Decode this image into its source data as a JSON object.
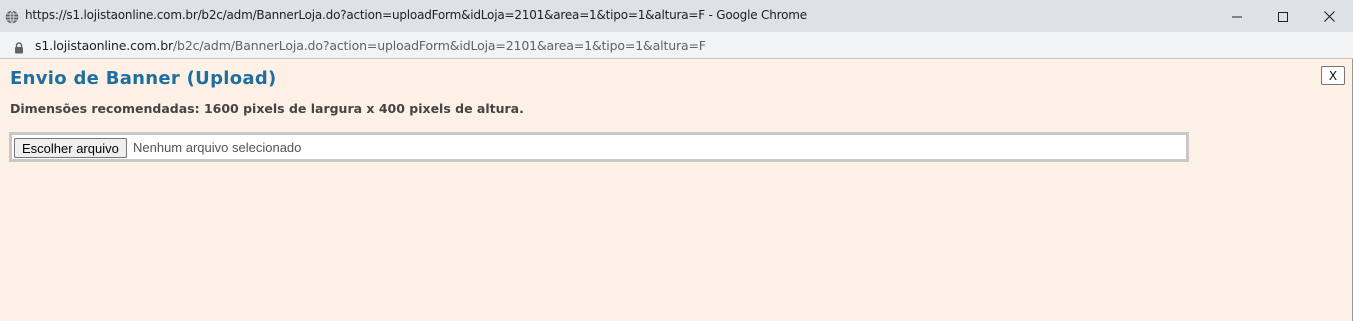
{
  "window": {
    "title": "https://s1.lojistaonline.com.br/b2c/adm/BannerLoja.do?action=uploadForm&idLoja=2101&area=1&tipo=1&altura=F - Google Chrome",
    "icons": {
      "site": "globe-icon",
      "minimize": "minimize-icon",
      "maximize": "maximize-icon",
      "close": "close-icon"
    }
  },
  "addressbar": {
    "icon": "lock-icon",
    "url_host": "s1.lojistaonline.com.br",
    "url_path": "/b2c/adm/BannerLoja.do?action=uploadForm&idLoja=2101&area=1&tipo=1&altura=F"
  },
  "page": {
    "title": "Envio de Banner (Upload)",
    "dimensions_note": "Dimensões recomendadas: 1600 pixels de largura x 400 pixels de altura.",
    "close_label": "X",
    "file_input": {
      "button_label": "Escolher arquivo",
      "status_text": "Nenhum arquivo selecionado"
    }
  },
  "colors": {
    "page_background": "#fdf0e4",
    "title_color": "#1e6fa0",
    "titlebar_background": "#dee1e6",
    "addressbar_background": "#f1f3f4"
  }
}
